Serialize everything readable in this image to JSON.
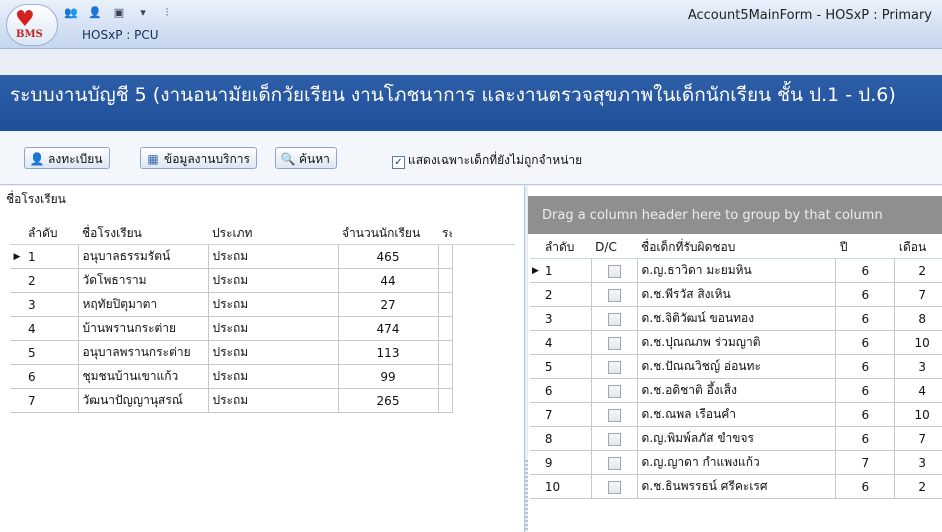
{
  "window": {
    "title": "Account5MainForm - HOSxP : Primary",
    "app_subtitle": "HOSxP : PCU",
    "logo_text": "BMS"
  },
  "banner": {
    "text": "ระบบงานบัญชี 5 (งานอนามัยเด็กวัยเรียน งานโภชนาการ และงานตรวจสุขภาพในเด็กนักเรียน ชั้น ป.1 - ป.6)"
  },
  "toolbar": {
    "register_label": "ลงทะเบียน",
    "service_label": "ข้อมูลงานบริการ",
    "search_label": "ค้นหา",
    "filter_label": "แสดงเฉพาะเด็กที่ยังไม่ถูกจำหน่าย",
    "filter_checked": "✓"
  },
  "schools": {
    "group_label": "ชื่อโรงเรียน",
    "columns": [
      "ลำดับ",
      "ชื่อโรงเรียน",
      "ประเภท",
      "จำนวนนักเรียน",
      "ระ"
    ],
    "rows": [
      {
        "no": "1",
        "name": "อนุบาลธรรมรัตน์",
        "type": "ประถม",
        "count": "465"
      },
      {
        "no": "2",
        "name": "วัดโพธาราม",
        "type": "ประถม",
        "count": "44"
      },
      {
        "no": "3",
        "name": "หฤทัยปิตุมาตา",
        "type": "ประถม",
        "count": "27"
      },
      {
        "no": "4",
        "name": "บ้านพรานกระต่าย",
        "type": "ประถม",
        "count": "474"
      },
      {
        "no": "5",
        "name": "อนุบาลพรานกระต่าย",
        "type": "ประถม",
        "count": "113"
      },
      {
        "no": "6",
        "name": "ชุมชนบ้านเขาแก้ว",
        "type": "ประถม",
        "count": "99"
      },
      {
        "no": "7",
        "name": "วัฒนาปัญญานุสรณ์",
        "type": "ประถม",
        "count": "265"
      }
    ]
  },
  "students": {
    "group_hint": "Drag a column header here to group by that column",
    "columns": [
      "ลำดับ",
      "D/C",
      "ชื่อเด็กที่รับผิดชอบ",
      "ปี",
      "เดือน"
    ],
    "rows": [
      {
        "no": "1",
        "name": "ด.ญ.ธาวิดา มะยมหิน",
        "year": "6",
        "month": "2"
      },
      {
        "no": "2",
        "name": "ด.ช.พีรวัส สิงเหิน",
        "year": "6",
        "month": "7"
      },
      {
        "no": "3",
        "name": "ด.ช.จิติวัฒน์ ขอนทอง",
        "year": "6",
        "month": "8"
      },
      {
        "no": "4",
        "name": "ด.ช.ปุณณภพ ร่วมญาติ",
        "year": "6",
        "month": "10"
      },
      {
        "no": "5",
        "name": "ด.ช.ปัณณวิชญ์ อ่อนทะ",
        "year": "6",
        "month": "3"
      },
      {
        "no": "6",
        "name": "ด.ช.อดิชาติ อึ้งเส็ง",
        "year": "6",
        "month": "4"
      },
      {
        "no": "7",
        "name": "ด.ช.ณพล เรือนคำ",
        "year": "6",
        "month": "10"
      },
      {
        "no": "8",
        "name": "ด.ญ.พิมพ์ลภัส ขำขจร",
        "year": "6",
        "month": "7"
      },
      {
        "no": "9",
        "name": "ด.ญ.ญาดา กำแพงแก้ว",
        "year": "7",
        "month": "3"
      },
      {
        "no": "10",
        "name": "ด.ช.ธินพรรธน์ ศรีคะเรศ",
        "year": "6",
        "month": "2"
      }
    ]
  },
  "colors": {
    "banner": "#2d5ea8",
    "group_area": "#8f8f8f"
  }
}
